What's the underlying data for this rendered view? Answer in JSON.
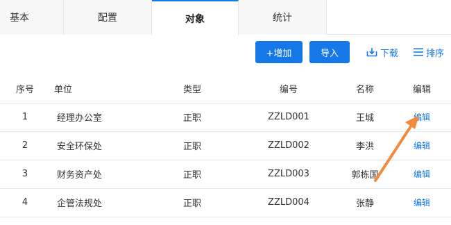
{
  "tabs": [
    {
      "label": "基本",
      "active": false
    },
    {
      "label": "配置",
      "active": false
    },
    {
      "label": "对象",
      "active": true
    },
    {
      "label": "统计",
      "active": false
    }
  ],
  "toolbar": {
    "add_label": "+增加",
    "import_label": "导入",
    "download_label": "下载",
    "sort_label": "排序",
    "download_icon": "download-icon",
    "sort_icon": "list-sort-icon"
  },
  "table": {
    "headers": {
      "index": "序号",
      "unit": "单位",
      "type": "类型",
      "code": "编号",
      "name": "名称",
      "edit": "编辑"
    },
    "rows": [
      {
        "index": "1",
        "unit": "经理办公室",
        "type": "正职",
        "code": "ZZLD001",
        "name": "王城",
        "edit": "编辑"
      },
      {
        "index": "2",
        "unit": "安全环保处",
        "type": "正职",
        "code": "ZZLD002",
        "name": "李洪",
        "edit": "编辑"
      },
      {
        "index": "3",
        "unit": "财务资产处",
        "type": "正职",
        "code": "ZZLD003",
        "name": "郭栋国",
        "edit": "编辑"
      },
      {
        "index": "4",
        "unit": "企管法规处",
        "type": "正职",
        "code": "ZZLD004",
        "name": "张静",
        "edit": "编辑"
      }
    ]
  },
  "colors": {
    "primary": "#1677e6",
    "annotation_arrow": "#f08a3c"
  }
}
